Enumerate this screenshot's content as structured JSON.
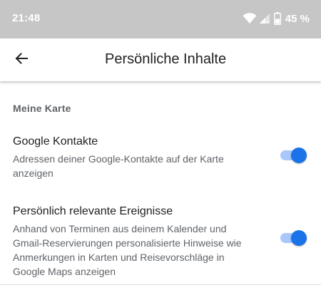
{
  "status_bar": {
    "time": "21:48",
    "battery": "45 %",
    "icons": [
      "wifi-icon",
      "signal-icon",
      "battery-icon"
    ]
  },
  "app_bar": {
    "back_icon": "arrow-back-icon",
    "title": "Persönliche Inhalte"
  },
  "section": {
    "header": "Meine Karte"
  },
  "settings": [
    {
      "title": "Google Kontakte",
      "description": "Adressen deiner Google-Kontakte auf der Karte anzeigen",
      "enabled": true
    },
    {
      "title": "Persönlich relevante Ereignisse",
      "description": "Anhand von Terminen aus deinem Kalender und Gmail-Reservierungen personalisierte Hinweise wie Anmerkungen in Karten und Reisevorschläge in Google Maps anzeigen",
      "enabled": true
    }
  ],
  "colors": {
    "status_bar_bg": "#c6c6c6",
    "toggle_on_thumb": "#1a73e8",
    "toggle_on_track": "#a8c7fa",
    "primary_text": "#202124",
    "secondary_text": "#5f6368"
  }
}
